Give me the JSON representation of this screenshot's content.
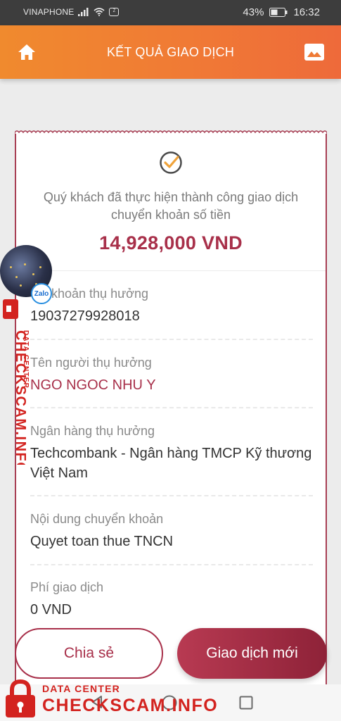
{
  "status_bar": {
    "carrier": "VINAPHONE",
    "battery": "43%",
    "time": "16:32"
  },
  "header": {
    "title": "KẾT QUẢ GIAO DỊCH"
  },
  "receipt": {
    "message": "Quý khách đã thực hiện thành công giao dịch chuyển khoản số tiền",
    "amount": "14,928,000 VND",
    "fields": [
      {
        "label": "Tài khoản thụ hưởng",
        "value": "19037279928018"
      },
      {
        "label": "Tên người thụ hưởng",
        "value": "NGO NGOC NHU Y"
      },
      {
        "label": "Ngân hàng thụ hưởng",
        "value": "Techcombank - Ngân hàng TMCP Kỹ thương Việt Nam"
      },
      {
        "label": "Nội dung chuyển khoản",
        "value": "Quyet toan thue TNCN"
      },
      {
        "label": "Phí giao dịch",
        "value": "0 VND"
      }
    ]
  },
  "actions": {
    "share": "Chia sẻ",
    "new_transaction": "Giao dịch mới"
  },
  "overlay": {
    "zalo_label": "Zalo",
    "watermark_sub": "DATA CENTER",
    "watermark_main": "CHECKSCAM.INFO"
  },
  "colors": {
    "accent": "#a8304a",
    "header_start": "#f08a2e",
    "header_end": "#ee6a3a",
    "watermark": "#d3231f"
  }
}
